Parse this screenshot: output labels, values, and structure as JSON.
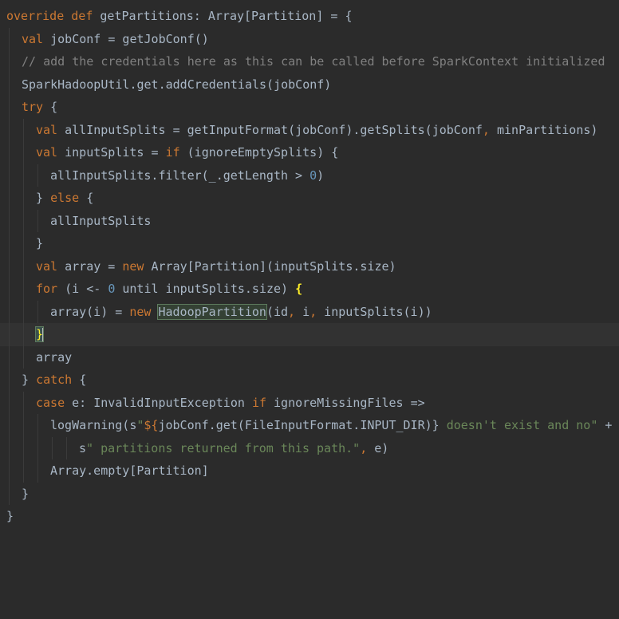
{
  "editor": {
    "language": "scala",
    "theme_colors": {
      "background": "#2b2b2b",
      "keyword": "#cc7832",
      "comment": "#808080",
      "number": "#6897bb",
      "string": "#6a8759",
      "identifier": "#a9b7c6",
      "usage_highlight": "#344134",
      "current_line": "#323232"
    },
    "lines": [
      {
        "text": "override def getPartitions: Array[Partition] = {"
      },
      {
        "text": "val jobConf = getJobConf()"
      },
      {
        "text": "// add the credentials here as this can be called before SparkContext initialized"
      },
      {
        "text": "SparkHadoopUtil.get.addCredentials(jobConf)"
      },
      {
        "text": "try {"
      },
      {
        "text": "val allInputSplits = getInputFormat(jobConf).getSplits(jobConf, minPartitions)"
      },
      {
        "text": "val inputSplits = if (ignoreEmptySplits) {"
      },
      {
        "text": "allInputSplits.filter(_.getLength > 0)"
      },
      {
        "text": "} else {"
      },
      {
        "text": "allInputSplits"
      },
      {
        "text": "}"
      },
      {
        "text": "val array = new Array[Partition](inputSplits.size)"
      },
      {
        "text": "for (i <- 0 until inputSplits.size) {"
      },
      {
        "text": "array(i) = new HadoopPartition(id, i, inputSplits(i))"
      },
      {
        "text": "}"
      },
      {
        "text": "array"
      },
      {
        "text": "} catch {"
      },
      {
        "text": "case e: InvalidInputException if ignoreMissingFiles =>"
      },
      {
        "text": "logWarning(s\"${jobConf.get(FileInputFormat.INPUT_DIR)} doesn't exist and no\" +"
      },
      {
        "text": "s\" partitions returned from this path.\", e)"
      },
      {
        "text": "Array.empty[Partition]"
      },
      {
        "text": "}"
      },
      {
        "text": "}"
      }
    ],
    "tokens": {
      "l0": [
        "override",
        " ",
        "def",
        " getPartitions: Array[Partition] = {"
      ],
      "l1": [
        "val",
        " jobConf = getJobConf()"
      ],
      "l3": [
        "SparkHadoopUtil.get.addCredentials(jobConf)"
      ],
      "l4": [
        "try",
        " {"
      ],
      "l5": [
        "val",
        " allInputSplits = getInputFormat(jobConf).getSplits(jobConf",
        ",",
        " minPartitions)"
      ],
      "l6": [
        "val",
        " inputSplits = ",
        "if",
        " (ignoreEmptySplits) {"
      ],
      "l7": [
        "allInputSplits.filter(_.getLength > ",
        "0",
        ")"
      ],
      "l8": [
        "} ",
        "else",
        " {"
      ],
      "l9": [
        "allInputSplits"
      ],
      "l10": [
        "}"
      ],
      "l11": [
        "val",
        " array = ",
        "new",
        " Array[Partition](inputSplits.size)"
      ],
      "l12": [
        "for",
        " (i <- ",
        "0",
        " until inputSplits.size) ",
        "{"
      ],
      "l13": [
        "array(i) = ",
        "new",
        " ",
        "HadoopPartition",
        "(id",
        ",",
        " i",
        ",",
        " inputSplits(i))"
      ],
      "l14": [
        "}"
      ],
      "l15": [
        "array"
      ],
      "l16": [
        "} ",
        "catch",
        " {"
      ],
      "l17": [
        "case",
        " e: InvalidInputException ",
        "if",
        " ignoreMissingFiles =>"
      ],
      "l18": [
        "logWarning(s",
        "\"",
        "${",
        "jobConf.get(FileInputFormat.INPUT_DIR)",
        "}",
        " doesn't exist and no\"",
        " +"
      ],
      "l19": [
        "s",
        "\" partitions returned from this path.\"",
        ",",
        " e)"
      ],
      "l20": [
        "Array.empty[Partition]"
      ],
      "l21": [
        "}"
      ],
      "l22": [
        "}"
      ]
    }
  }
}
